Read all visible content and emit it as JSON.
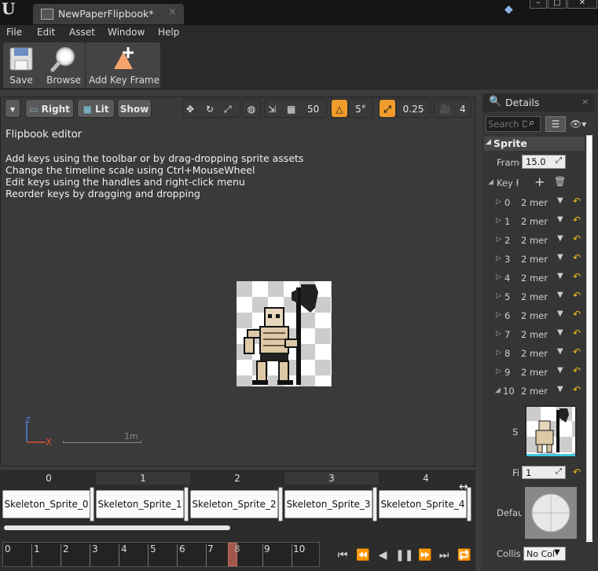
{
  "window": {
    "tab_title": "NewPaperFlipbook*",
    "tab_close": "×",
    "logo": "U",
    "controls": [
      "–",
      "□",
      "✕"
    ]
  },
  "menu": [
    "File",
    "Edit",
    "Asset",
    "Window",
    "Help"
  ],
  "toolbar": {
    "save_label": "Save",
    "browse_label": "Browse",
    "add_key_frame_label": "Add Key Frame"
  },
  "viewport_toolbar": {
    "view_mode": "Right",
    "lighting": "Lit",
    "show": "Show",
    "grid_snap": "50",
    "rotation_snap": "5°",
    "scale_snap": "0.25",
    "camera_speed": "4"
  },
  "viewport": {
    "title": "Flipbook editor",
    "help_lines": [
      "Add keys using the toolbar or by drag-dropping sprite assets",
      "Change the timeline scale using Ctrl+MouseWheel",
      "Edit keys using the handles and right-click menu",
      "Reorder keys by dragging and dropping"
    ],
    "scale_label": "1m",
    "axis_z": "Z",
    "axis_x": "X"
  },
  "timeline": {
    "frame_numbers": [
      "0",
      "1",
      "2",
      "3",
      "4"
    ],
    "frames": [
      "Skeleton_Sprite_0",
      "Skeleton_Sprite_1",
      "Skeleton_Sprite_2",
      "Skeleton_Sprite_3",
      "Skeleton_Sprite_4"
    ],
    "ruler_ticks": [
      "0",
      "1",
      "2",
      "3",
      "4",
      "5",
      "6",
      "7",
      "8",
      "9",
      "10"
    ],
    "current_frame": "8"
  },
  "details": {
    "title": "Details",
    "close": "×",
    "search_placeholder": "Search D",
    "section": "Sprite",
    "frames_per_second_label": "Frame",
    "frames_per_second_value": "15.0",
    "key_frames_label": "Key F",
    "key_frames": [
      {
        "index": "0",
        "value": "2 mem"
      },
      {
        "index": "1",
        "value": "2 mem"
      },
      {
        "index": "2",
        "value": "2 mem"
      },
      {
        "index": "3",
        "value": "2 mem"
      },
      {
        "index": "4",
        "value": "2 mem"
      },
      {
        "index": "5",
        "value": "2 mem"
      },
      {
        "index": "6",
        "value": "2 mem"
      },
      {
        "index": "7",
        "value": "2 mem"
      },
      {
        "index": "8",
        "value": "2 mem"
      },
      {
        "index": "9",
        "value": "2 mem"
      },
      {
        "index": "10",
        "value": "2 mem"
      }
    ],
    "sprite_label": "S",
    "frame_run_label": "Fi",
    "frame_run_value": "1",
    "default_material_label": "Defau",
    "collision_label": "Collis",
    "collision_value": "No Col"
  },
  "colors": {
    "accent_orange": "#f19c2a",
    "reset_yellow": "#f0c020",
    "playhead": "#a0564c"
  }
}
